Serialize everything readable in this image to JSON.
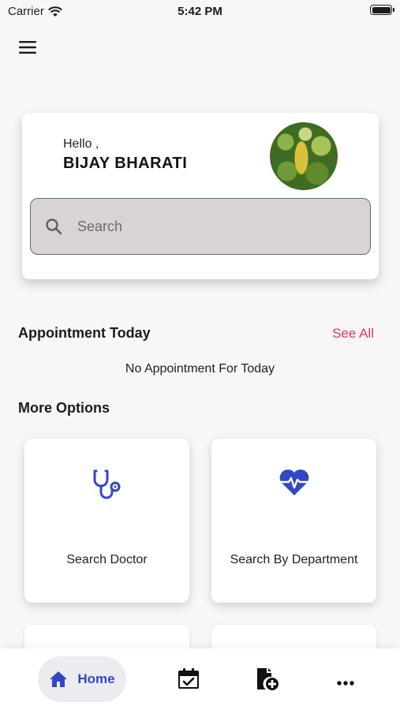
{
  "status_bar": {
    "carrier": "Carrier",
    "time": "5:42 PM"
  },
  "profile": {
    "greeting": "Hello ,",
    "name": "BIJAY BHARATI"
  },
  "search": {
    "placeholder": "Search"
  },
  "appointments": {
    "title": "Appointment Today",
    "see_all": "See All",
    "empty_message": "No Appointment For Today"
  },
  "more_options": {
    "title": "More Options",
    "items": [
      {
        "label": "Search Doctor",
        "icon": "stethoscope-icon"
      },
      {
        "label": "Search By Department",
        "icon": "heartbeat-icon"
      }
    ]
  },
  "bottom_nav": {
    "items": [
      {
        "label": "Home",
        "icon": "home-icon",
        "active": true
      },
      {
        "label": "",
        "icon": "calendar-check-icon"
      },
      {
        "label": "",
        "icon": "medical-file-icon"
      },
      {
        "label": "",
        "icon": "more-icon"
      }
    ]
  },
  "colors": {
    "accent": "#3347c6",
    "see_all": "#e0336d",
    "search_bg": "#d9d3d3",
    "background": "#f7f7f8"
  }
}
